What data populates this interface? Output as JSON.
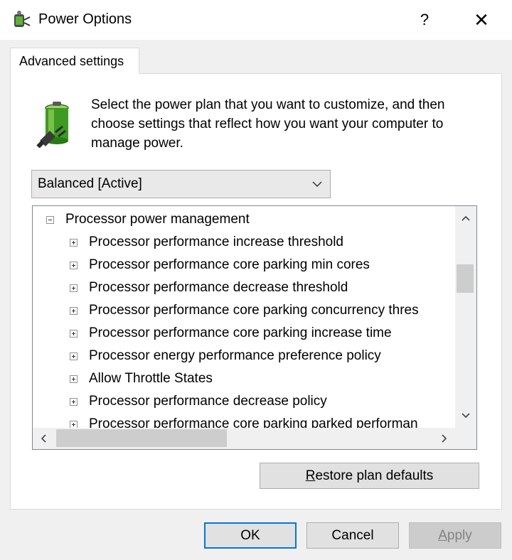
{
  "window": {
    "title": "Power Options",
    "help_label": "?",
    "close_label": "✕"
  },
  "tab": {
    "label": "Advanced settings"
  },
  "description": "Select the power plan that you want to customize, and then choose settings that reflect how you want your computer to manage power.",
  "plan_select": {
    "value": "Balanced [Active]"
  },
  "tree": {
    "parent": {
      "label": "Processor power management",
      "expanded": true
    },
    "items": [
      "Processor performance increase threshold",
      "Processor performance core parking min cores",
      "Processor performance decrease threshold",
      "Processor performance core parking concurrency thres",
      "Processor performance core parking increase time",
      "Processor energy performance preference policy",
      "Allow Throttle States",
      "Processor performance decrease policy",
      "Processor performance core parking parked performan"
    ]
  },
  "buttons": {
    "restore": {
      "mnemonic": "R",
      "rest": "estore plan defaults"
    },
    "ok": "OK",
    "cancel": "Cancel",
    "apply": {
      "mnemonic": "A",
      "rest": "pply",
      "disabled": true
    }
  },
  "colors": {
    "dialog_bg": "#f0f0f0",
    "default_button_border": "#0078d7",
    "battery_green": "#3c9b20"
  },
  "icons": {
    "app": "power-plug-icon",
    "battery": "battery-plug-icon",
    "dropdown": "chevron-down-icon"
  }
}
